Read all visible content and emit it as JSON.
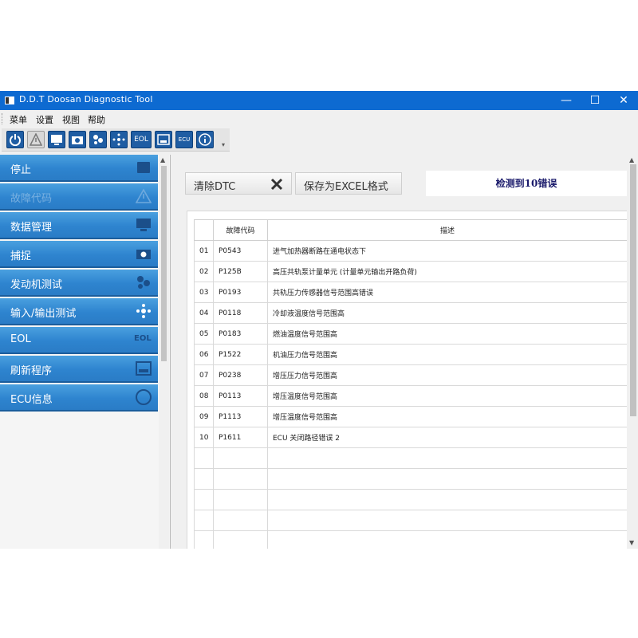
{
  "window": {
    "title": "D.D.T Doosan Diagnostic Tool"
  },
  "menu": [
    "菜单",
    "设置",
    "视图",
    "帮助"
  ],
  "toolbar": {
    "icons": [
      "power-icon",
      "warning-icon",
      "monitor-icon",
      "camera-icon",
      "engine-icon",
      "io-icon",
      "eol-icon",
      "flash-icon",
      "ecu-icon",
      "info-icon"
    ],
    "eol_text": "EOL",
    "ecu_text": "ECU"
  },
  "sidebar": {
    "items": [
      {
        "label": "停止",
        "icon": "stop-icon"
      },
      {
        "label": "故障代码",
        "icon": "warning-icon"
      },
      {
        "label": "数据管理",
        "icon": "monitor-icon"
      },
      {
        "label": "捕捉",
        "icon": "camera-icon"
      },
      {
        "label": "发动机测试",
        "icon": "engine-icon"
      },
      {
        "label": "输入/输出测试",
        "icon": "io-icon"
      },
      {
        "label": "EOL",
        "icon": "eol-icon"
      },
      {
        "label": "刷新程序",
        "icon": "flash-icon"
      },
      {
        "label": "ECU信息",
        "icon": "ecu-icon"
      }
    ]
  },
  "actions": {
    "clear_dtc": "清除DTC",
    "save_excel": "保存为EXCEL格式"
  },
  "status": {
    "text": "检测到10错误"
  },
  "table": {
    "headers": [
      "",
      "故障代码",
      "描述"
    ],
    "rows": [
      [
        "01",
        "P0543",
        "进气加热器断路在通电状态下"
      ],
      [
        "02",
        "P125B",
        "高压共轨泵计量单元 (计量单元输出开路负荷)"
      ],
      [
        "03",
        "P0193",
        "共轨压力传感器信号范围高错误"
      ],
      [
        "04",
        "P0118",
        "冷却液温度信号范围高"
      ],
      [
        "05",
        "P0183",
        "燃油温度信号范围高"
      ],
      [
        "06",
        "P1522",
        "机油压力信号范围高"
      ],
      [
        "07",
        "P0238",
        "增压压力信号范围高"
      ],
      [
        "08",
        "P0113",
        "增压温度信号范围高"
      ],
      [
        "09",
        "P1113",
        "增压温度信号范围高"
      ],
      [
        "10",
        "P1611",
        "ECU 关闭路径错误 2"
      ]
    ],
    "empty_rows": 7
  },
  "colors": {
    "titlebar": "#0d6ad1",
    "nav": "#2e84cf",
    "status_text": "#1a1a6b"
  }
}
